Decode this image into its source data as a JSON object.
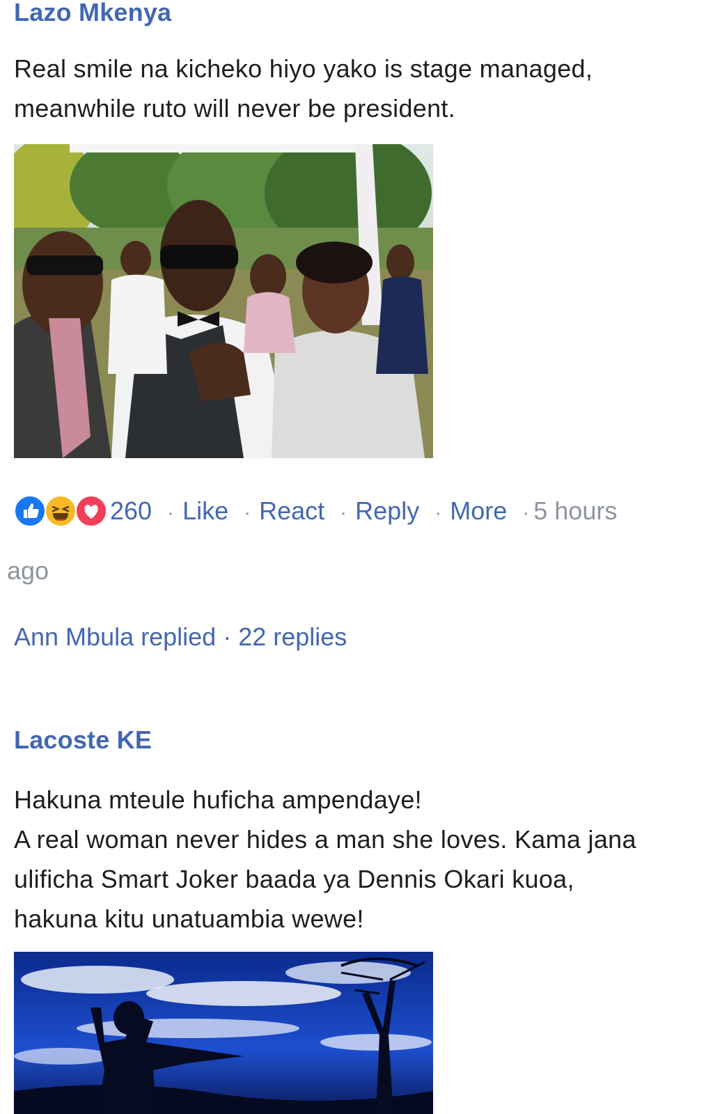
{
  "comments": [
    {
      "author": "Lazo Mkenya",
      "text_lines": [
        "Real smile na kicheko hiyo yako is stage managed,",
        "meanwhile ruto will never be president."
      ],
      "image": "wedding-photo",
      "reaction_icons": [
        "like-icon",
        "haha-icon",
        "love-icon"
      ],
      "reaction_count": "260",
      "actions": {
        "like": "Like",
        "react": "React",
        "reply": "Reply",
        "more": "More"
      },
      "separator": "·",
      "time_first": "5 hours",
      "time_second": "ago",
      "replies_author": "Ann Mbula replied",
      "replies_count": "· 22 replies"
    },
    {
      "author": "Lacoste KE",
      "text_lines": [
        "Hakuna mteule huficha ampendaye!",
        "A real woman never hides a man she loves.  Kama jana",
        "ulificha Smart Joker baada ya Dennis Okari kuoa,",
        "hakuna kitu unatuambia wewe!"
      ],
      "image": "sky-silhouette-photo"
    }
  ],
  "colors": {
    "link": "#4267b2",
    "text": "#1c1e21",
    "meta": "#8d949e",
    "like": "#1877f2",
    "haha": "#f7b928",
    "love": "#f33e58"
  }
}
